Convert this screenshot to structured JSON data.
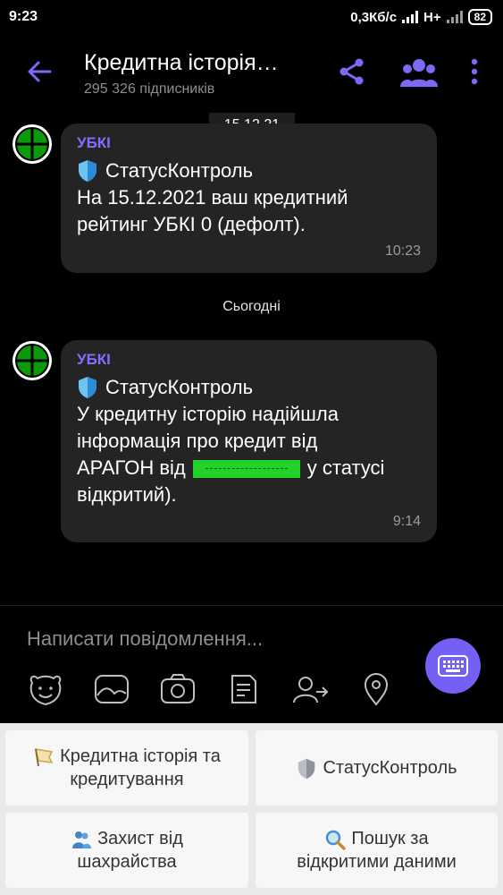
{
  "status_bar": {
    "time": "9:23",
    "network_speed": "0,3Кб/с",
    "network_type": "H+",
    "battery": "82"
  },
  "header": {
    "title": "Кредитна історія…",
    "subscribers": "295 326 підписників"
  },
  "chat": {
    "date_pill": "15.12.21",
    "day_separator": "Сьогодні",
    "messages": [
      {
        "sender": "УБКІ",
        "heading": "СтатусКонтроль",
        "lines": [
          "На 15.12.2021 ваш кредитний",
          "рейтинг УБКІ 0 (дефолт)."
        ],
        "time": "10:23"
      },
      {
        "sender": "УБКІ",
        "heading": "СтатусКонтроль",
        "lines": [
          "У кредитну історію надійшла",
          "інформація про кредит від",
          "АРАГОН від",
          "у статусі",
          "відкритий)."
        ],
        "time": "9:14"
      }
    ]
  },
  "composer": {
    "placeholder": "Написати повідомлення..."
  },
  "bot_keyboard": {
    "btn1": [
      "Кредитна історія та",
      "кредитування"
    ],
    "btn2": "СтатусКонтроль",
    "btn3": [
      "Захист від",
      "шахрайства"
    ],
    "btn4": [
      "Пошук за",
      "відкритими даними"
    ]
  },
  "colors": {
    "accent": "#7460f5",
    "sender": "#8a6bff",
    "bubble": "#242424",
    "redaction": "#22d22b"
  }
}
